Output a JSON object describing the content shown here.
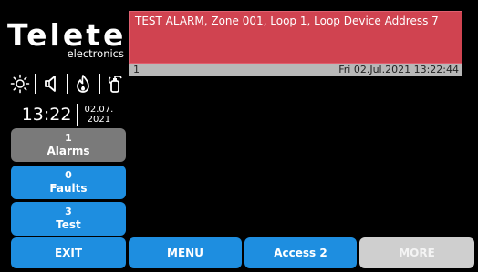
{
  "brand": {
    "name": "Teletek",
    "tagline": "electronics"
  },
  "status_icons": [
    "sun-icon",
    "speaker-icon",
    "fire-icon",
    "extinguisher-icon"
  ],
  "clock": {
    "time": "13:22",
    "date_line1": "02.07.",
    "date_line2": "2021"
  },
  "sidebar": {
    "alarms": {
      "count": "1",
      "label": "Alarms"
    },
    "faults": {
      "count": "0",
      "label": "Faults"
    },
    "test": {
      "count": "3",
      "label": "Test"
    }
  },
  "alarm_event": {
    "message": "TEST ALARM, Zone 001, Loop 1, Loop Device Address 7",
    "index": "1",
    "timestamp": "Fri 02.Jul.2021 13:22:44"
  },
  "bottom_bar": {
    "exit": "EXIT",
    "menu": "MENU",
    "access": "Access 2",
    "more": "MORE"
  },
  "colors": {
    "background": "#000000",
    "button_blue": "#1e8ee0",
    "alarm_red": "#d04350",
    "disabled_gray": "#cfcfcf",
    "alarms_gray": "#7a7a7a"
  }
}
